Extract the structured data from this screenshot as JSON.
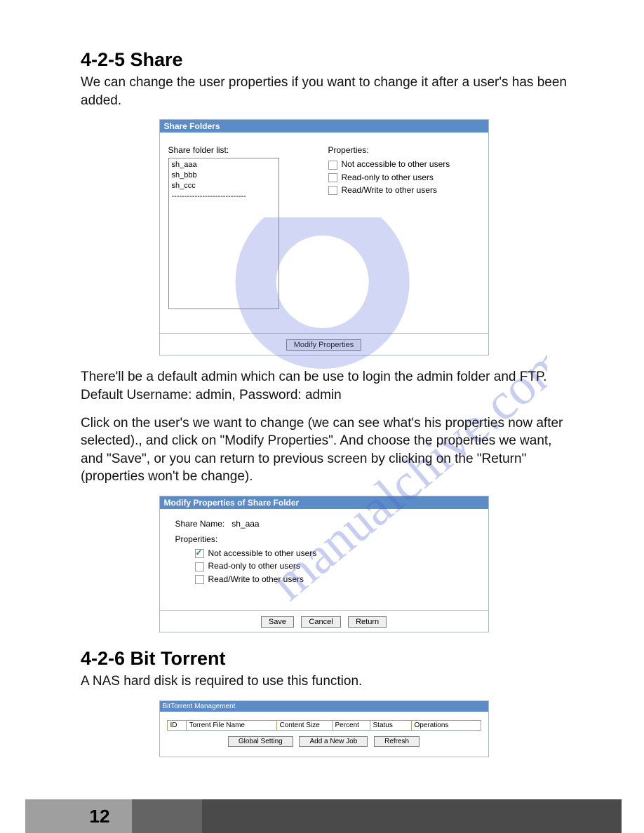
{
  "page_number": "12",
  "section1": {
    "heading": "4-2-5 Share",
    "intro": "We can change the user properties if you want to change it after a user's has been added.",
    "para2": "There'll be a default admin which can be use to login the admin folder and FTP. Default Username: admin, Password: admin",
    "para3": "Click on the user's we want to change (we can see what's his properties now after selected)., and click on \"Modify Properties\". And choose the properties we want, and \"Save\", or you can return to previous screen by clicking on the \"Return\" (properties won't be change)."
  },
  "panel1": {
    "header": "Share Folders",
    "list_label": "Share folder list:",
    "items": {
      "a": "sh_aaa",
      "b": "sh_bbb",
      "c": "sh_ccc",
      "sep": "-----------------------------"
    },
    "props_label": "Properties:",
    "opt1": "Not accessible to other users",
    "opt2": "Read-only to other users",
    "opt3": "Read/Write to other users",
    "modify_btn": "Modify Properties"
  },
  "panel2": {
    "header": "Modify Properties of Share Folder",
    "share_label": "Share Name:",
    "share_value": "sh_aaa",
    "props_label": "Properities:",
    "opt1": "Not accessible to other users",
    "opt2": "Read-only to other users",
    "opt3": "Read/Write to other users",
    "save": "Save",
    "cancel": "Cancel",
    "return": "Return"
  },
  "section2": {
    "heading": "4-2-6 Bit Torrent",
    "intro": "A NAS hard disk is required to use this function."
  },
  "panel3": {
    "header": "BitTorrent Management",
    "cols": {
      "id": "ID",
      "name": "Torrent File Name",
      "size": "Content Size",
      "pct": "Percent",
      "status": "Status",
      "ops": "Operations"
    },
    "global": "Global Setting",
    "add": "Add a New Job",
    "refresh": "Refresh"
  },
  "watermark_text": "manualchive.com"
}
